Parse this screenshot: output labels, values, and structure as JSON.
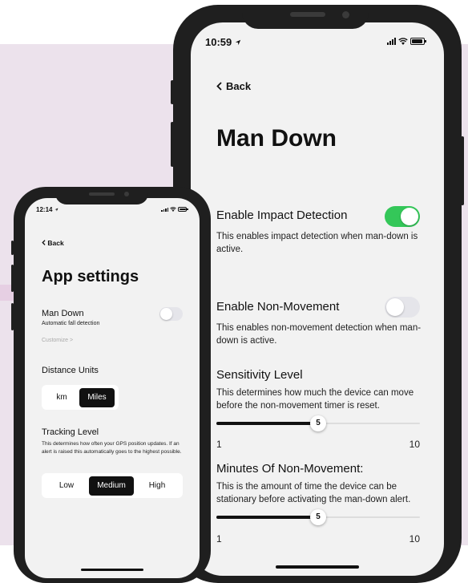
{
  "large_phone": {
    "status_time": "10:59",
    "back_label": "Back",
    "title": "Man Down",
    "impact": {
      "title": "Enable Impact Detection",
      "description": "This enables impact detection when man-down is active.",
      "enabled": true
    },
    "non_movement": {
      "title": "Enable Non-Movement",
      "description": "This enables non-movement detection when man-down is active.",
      "enabled": false
    },
    "sensitivity": {
      "title": "Sensitivity Level",
      "description": "This determines how much the device can move before the non-movement timer is reset.",
      "value": "5",
      "min": "1",
      "max": "10"
    },
    "minutes": {
      "title": "Minutes Of Non-Movement:",
      "description": "This is the amount of time the device can be stationary before activating the man-down alert.",
      "value": "5",
      "min": "1",
      "max": "10"
    }
  },
  "small_phone": {
    "status_time": "12:14",
    "back_label": "Back",
    "title": "App settings",
    "man_down": {
      "label": "Man Down",
      "sublabel": "Automatic fall detection",
      "enabled": false,
      "customize_link": "Customize >"
    },
    "distance_units": {
      "label": "Distance Units",
      "options": [
        "km",
        "Miles"
      ],
      "selected": "Miles"
    },
    "tracking_level": {
      "label": "Tracking Level",
      "description": "This determines how often your GPS position updates. If an alert is raised this automatically goes to the highest possible.",
      "options": [
        "Low",
        "Medium",
        "High"
      ],
      "selected": "Medium"
    }
  },
  "colors": {
    "background_panel": "#ece2ec",
    "toggle_on": "#34c759",
    "toggle_off": "#e5e5ea",
    "selected_segment": "#111111"
  },
  "icons": {
    "back": "chevron-left-icon",
    "location": "location-arrow-icon",
    "signal": "signal-icon",
    "wifi": "wifi-icon",
    "battery": "battery-icon"
  }
}
